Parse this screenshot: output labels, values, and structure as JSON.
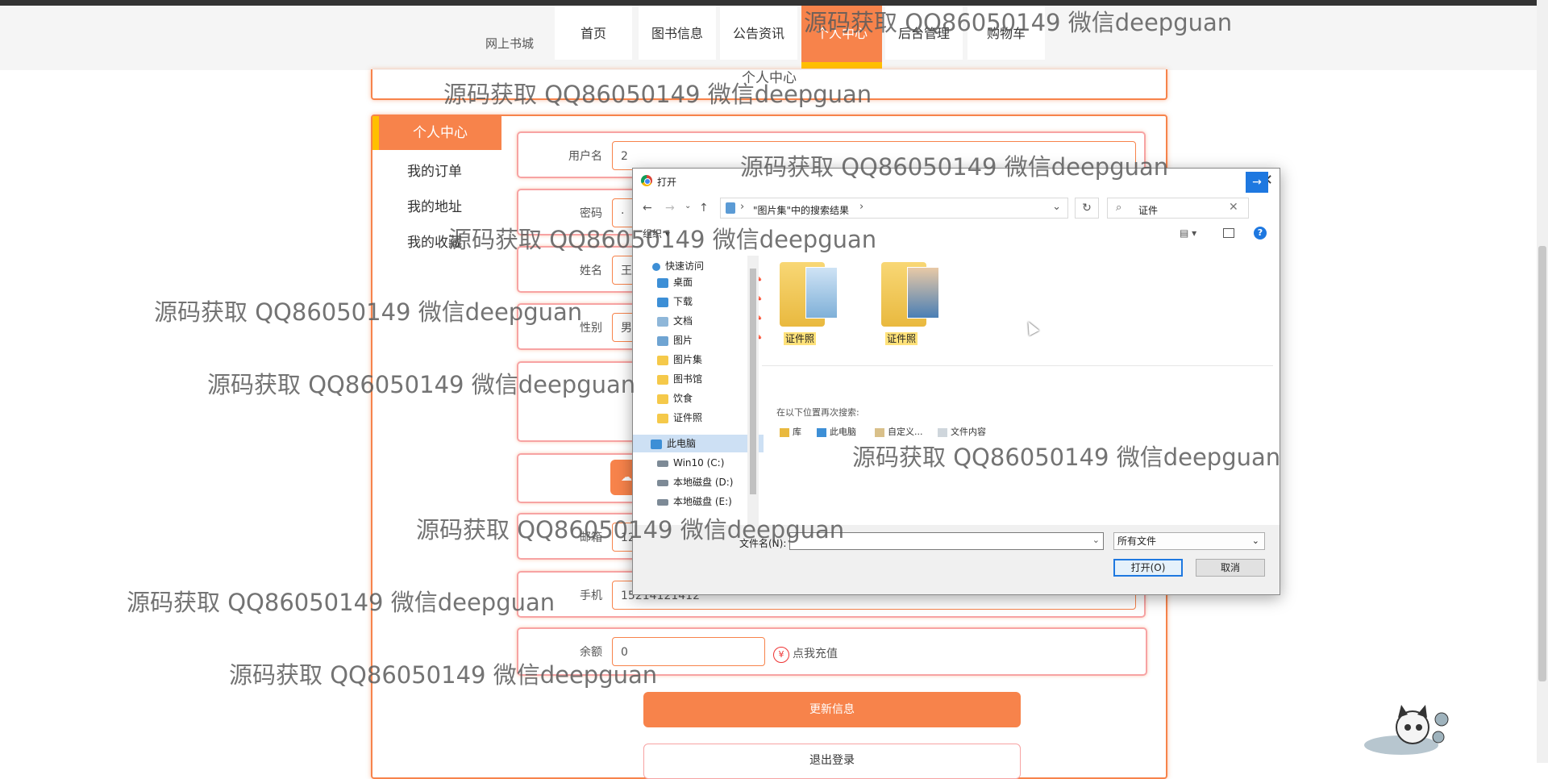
{
  "nav": {
    "brand": "网上书城",
    "items": [
      "首页",
      "图书信息",
      "公告资讯",
      "个人中心",
      "后台管理",
      "购物车"
    ]
  },
  "header": {
    "title": "个人中心"
  },
  "sidebar": {
    "active": "个人中心",
    "items": [
      "我的订单",
      "我的地址",
      "我的收藏"
    ]
  },
  "form": {
    "username_label": "用户名",
    "username_value": "2",
    "password_label": "密码",
    "password_value": "·",
    "name_label": "姓名",
    "name_value": "王",
    "gender_label": "性别",
    "gender_value": "男",
    "email_label": "邮箱",
    "email_value": "12",
    "phone_label": "手机",
    "phone_value": "15214121412",
    "balance_label": "余额",
    "balance_value": "0",
    "recharge_label": "点我充值",
    "recharge_icon": "¥",
    "upload_icon": "☁",
    "update_button": "更新信息",
    "logout_button": "退出登录"
  },
  "dialog": {
    "title": "打开",
    "close": "✕",
    "breadcrumb": "\"图片集\"中的搜索结果",
    "search_value": "证件",
    "organize": "组织 ▾",
    "nav_pane": [
      {
        "label": "快速访问",
        "icon": "star-icon"
      },
      {
        "label": "桌面",
        "icon": "desktop-icon",
        "pinned": true
      },
      {
        "label": "下载",
        "icon": "download-icon",
        "pinned": true
      },
      {
        "label": "文档",
        "icon": "document-icon",
        "pinned": true
      },
      {
        "label": "图片",
        "icon": "picture-icon",
        "pinned": true
      },
      {
        "label": "图片集",
        "icon": "folder-icon"
      },
      {
        "label": "图书馆",
        "icon": "folder-icon"
      },
      {
        "label": "饮食",
        "icon": "folder-icon"
      },
      {
        "label": "证件照",
        "icon": "folder-icon"
      },
      {
        "label": "此电脑",
        "icon": "computer-icon"
      },
      {
        "label": "Win10 (C:)",
        "icon": "drive-icon"
      },
      {
        "label": "本地磁盘 (D:)",
        "icon": "drive-icon"
      },
      {
        "label": "本地磁盘 (E:)",
        "icon": "drive-icon"
      }
    ],
    "files": [
      "证件照",
      "证件照"
    ],
    "search_again_label": "在以下位置再次搜索:",
    "search_again_items": [
      "库",
      "此电脑",
      "自定义...",
      "文件内容"
    ],
    "filename_label": "文件名(N):",
    "filename_value": "",
    "filetype_value": "所有文件",
    "open_button": "打开(O)",
    "cancel_button": "取消"
  },
  "watermarks": [
    "源码获取 QQ86050149 微信deepguan",
    "源码获取 QQ86050149 微信deepguan",
    "源码获取 QQ86050149 微信deepguan",
    "源码获取 QQ86050149 微信deepguan",
    "源码获取 QQ86050149 微信deepguan",
    "源码获取 QQ86050149 微信deepguan",
    "源码获取 QQ86050149 微信deepguan",
    "源码获取 QQ86050149 微信deepguan",
    "源码获取 QQ86050149 微信deepguan",
    "源码获取 QQ86050149 微信deepguan",
    "源码获取 QQ86050149 微信deepguan"
  ],
  "colors": {
    "accent": "#f7834b",
    "highlight": "#ffc000",
    "dialog_blue": "#1e78e0"
  }
}
